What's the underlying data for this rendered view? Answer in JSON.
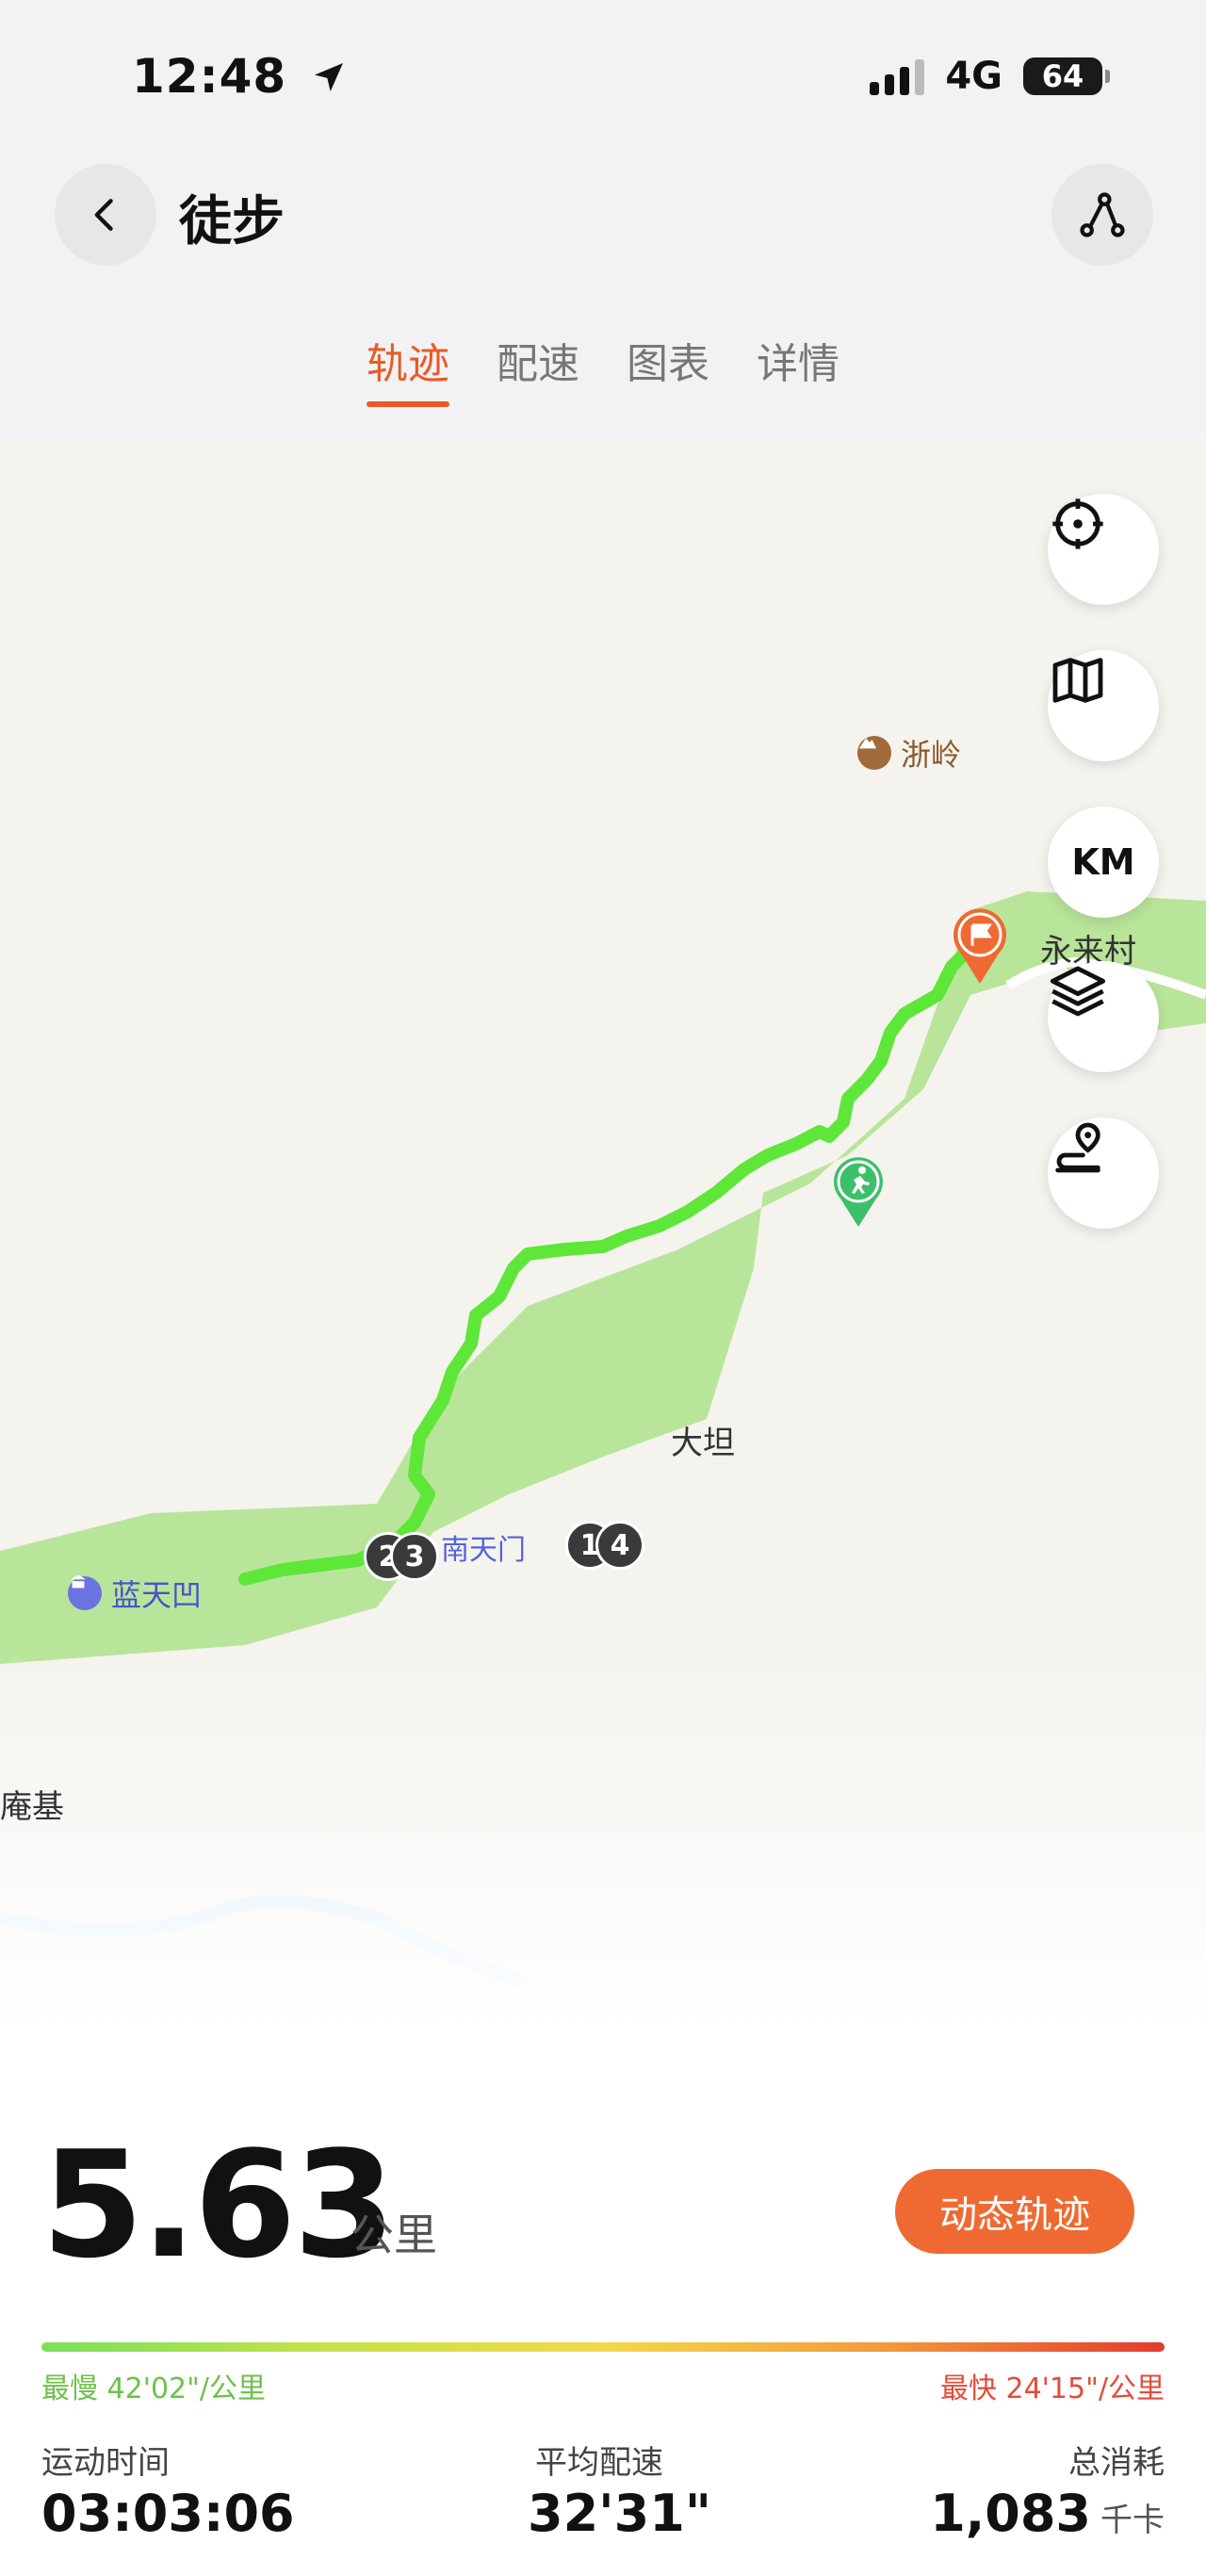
{
  "status_bar": {
    "time": "12:48",
    "network": "4G",
    "battery": "64"
  },
  "header": {
    "title": "徒步"
  },
  "tabs": [
    {
      "label": "轨迹",
      "active": true
    },
    {
      "label": "配速",
      "active": false
    },
    {
      "label": "图表",
      "active": false
    },
    {
      "label": "详情",
      "active": false
    }
  ],
  "map": {
    "labels": {
      "zheling": "浙岭",
      "yonglaicun": "永来村",
      "datan": "大坦",
      "nantianmen": "南天门",
      "lantianao": "蓝天凹",
      "anji": "庵基"
    },
    "controls": {
      "km": "KM"
    },
    "km_markers": [
      "1",
      "4",
      "2",
      "3"
    ],
    "route_color": "#5ee639",
    "area_color": "#b9e59a"
  },
  "summary": {
    "distance": "5.63",
    "distance_unit": "公里",
    "dynamic_track": "动态轨迹",
    "slowest": "最慢 42'02\"/公里",
    "fastest": "最快 24'15\"/公里",
    "stats": {
      "duration_label": "运动时间",
      "duration_value": "03:03:06",
      "pace_label": "平均配速",
      "pace_value": "32'31\"",
      "calories_label": "总消耗",
      "calories_value": "1,083",
      "calories_unit": "千卡"
    }
  }
}
